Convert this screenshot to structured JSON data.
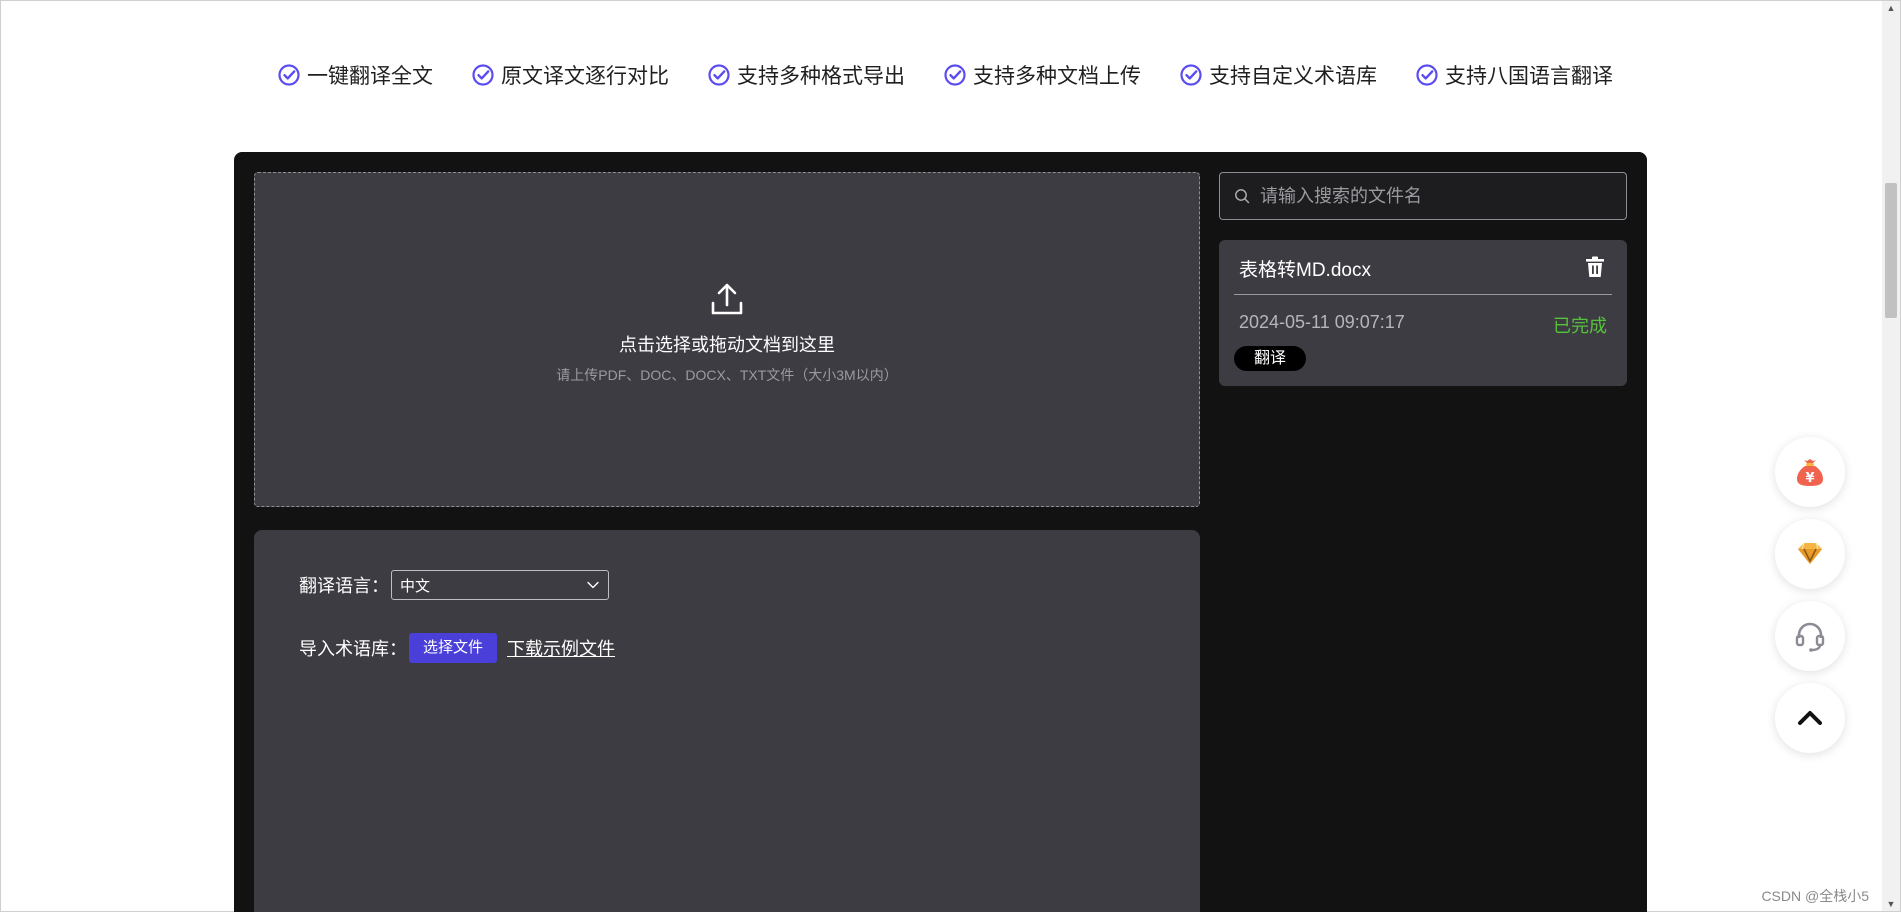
{
  "features": [
    {
      "label": "一键翻译全文",
      "icon": "check-circle-icon"
    },
    {
      "label": "原文译文逐行对比",
      "icon": "check-circle-icon"
    },
    {
      "label": "支持多种格式导出",
      "icon": "check-circle-icon"
    },
    {
      "label": "支持多种文档上传",
      "icon": "check-circle-icon"
    },
    {
      "label": "支持自定义术语库",
      "icon": "check-circle-icon"
    },
    {
      "label": "支持八国语言翻译",
      "icon": "check-circle-icon"
    }
  ],
  "upload": {
    "title": "点击选择或拖动文档到这里",
    "hint": "请上传PDF、DOC、DOCX、TXT文件（大小3M以内）",
    "icon": "upload-icon"
  },
  "settings": {
    "lang_label": "翻译语言：",
    "lang_value": "中文",
    "term_label": "导入术语库：",
    "choose_file": "选择文件",
    "download_sample": "下载示例文件"
  },
  "search": {
    "placeholder": "请输入搜索的文件名"
  },
  "files": [
    {
      "name": "表格转MD.docx",
      "time": "2024-05-11 09:07:17",
      "status": "已完成",
      "tag": "翻译"
    }
  ],
  "floating": [
    "money-bag-icon",
    "diamond-icon",
    "headset-icon",
    "chevron-up-icon"
  ],
  "watermark": "CSDN @全栈小5",
  "colors": {
    "accent": "#4a3fd8",
    "check": "#5b4cf0",
    "status_done": "#55c23a",
    "panel_bg": "#121212",
    "card_bg": "#3c3c42"
  }
}
